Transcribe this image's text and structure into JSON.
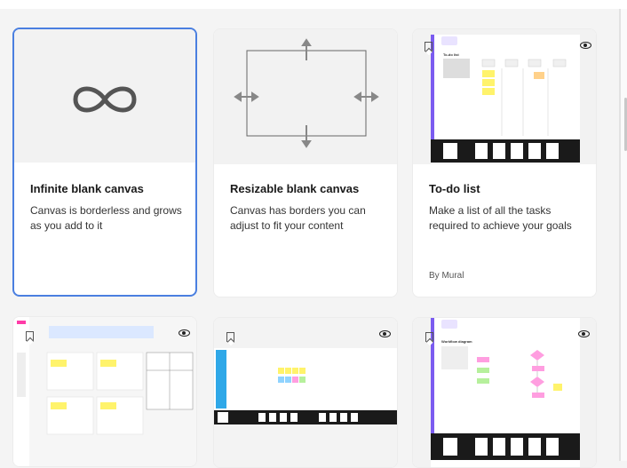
{
  "templates": [
    {
      "title": "Infinite blank canvas",
      "description": "Canvas is borderless and grows as you add to it",
      "selected": true,
      "preview_icon": "infinity-icon"
    },
    {
      "title": "Resizable blank canvas",
      "description": "Canvas has borders you can adjust to fit your content",
      "preview_icon": "resize-arrows-icon"
    },
    {
      "title": "To-do list",
      "description": "Make a list of all the tasks required to achieve your goals",
      "author": "By Mural",
      "preview_heading": "To-do list"
    },
    {
      "title": "",
      "preview_icon": "canvas-preview"
    },
    {
      "title": "",
      "preview_icon": "kanban-preview"
    },
    {
      "title": "",
      "preview_heading": "Workflow diagram"
    }
  ],
  "colors": {
    "selected_border": "#4a7fe0",
    "accent_purple": "#7b5cf0",
    "sticky_yellow": "#fff36b",
    "sticky_pink": "#ff9ee0",
    "sticky_blue": "#8fd3ff",
    "sticky_green": "#b6f09c"
  }
}
